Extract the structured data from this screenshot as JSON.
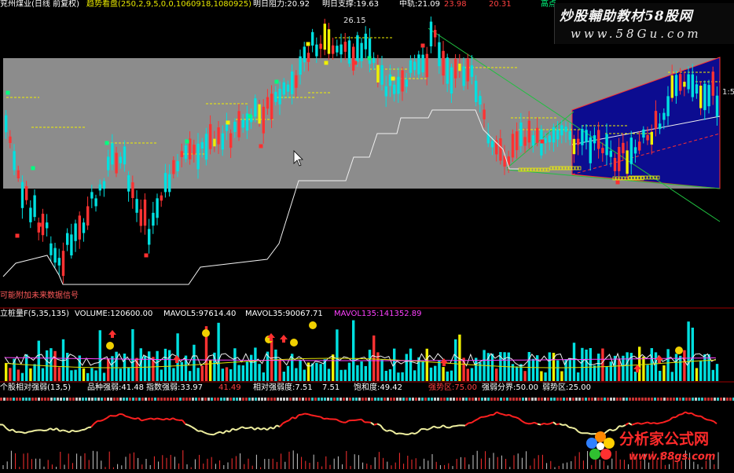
{
  "main_header": [
    {
      "text": "兖州煤业(日线 前复权)",
      "color": "#ffffff"
    },
    {
      "text": "趋势看盘(250,2,9,5,0,0,1060918,1080925)",
      "color": "#e6e600"
    },
    {
      "text": "明日阻力:20.92",
      "color": "#ffffff"
    },
    {
      "text": "明日支撑:19.63",
      "color": "#ffffff"
    },
    {
      "text": "中轨:21.09",
      "color": "#ffffff"
    },
    {
      "text": "23.98",
      "color": "#ff4040"
    },
    {
      "text": "20.31",
      "color": "#ff4040"
    },
    {
      "text": "高点",
      "color": "#00ff80"
    }
  ],
  "price_labels": [
    "26.15",
    "1:5"
  ],
  "bottom_note": "可能附加未来数据信号",
  "volume_header": [
    {
      "text": "立桩量F(5,35,135)",
      "color": "#ffffff"
    },
    {
      "text": "VOLUME:120600.00",
      "color": "#ffffff"
    },
    {
      "text": "MAVOL5:97614.40",
      "color": "#ffffff"
    },
    {
      "text": "MAVOL35:90067.71",
      "color": "#ffffff"
    },
    {
      "text": "MAVOL135:141352.89",
      "color": "#ff40ff"
    }
  ],
  "strength_header": [
    {
      "text": "个股相对强弱(13,5)",
      "color": "#ffffff"
    },
    {
      "text": "品种强弱:41.48",
      "color": "#ffffff"
    },
    {
      "text": "指数强弱:33.97",
      "color": "#ffffff"
    },
    {
      "text": "41.49",
      "color": "#ff4040"
    },
    {
      "text": "相对强弱度:7.51",
      "color": "#ffffff"
    },
    {
      "text": "7.51",
      "color": "#ffffff"
    },
    {
      "text": "饱和度:49.42",
      "color": "#ffffff"
    },
    {
      "text": "强势区:75.00",
      "color": "#ff4040"
    },
    {
      "text": "强弱分界:50.00",
      "color": "#ffffff"
    },
    {
      "text": "弱势区:25.00",
      "color": "#ffffff"
    }
  ],
  "watermark_top": {
    "title": "炒股輔助教材58股网",
    "url": "www.58Gu.com"
  },
  "watermark_bottom": {
    "title": "分析家公式网",
    "url": "www.88gs.com"
  },
  "colors": {
    "up": "#ff3232",
    "down": "#00e0e0",
    "gray_band": "#8c8c8c",
    "channel": "#0a0a8c",
    "support_line": "#f0f0f0",
    "trend_green": "#20c040",
    "yellow": "#f0f000"
  }
}
